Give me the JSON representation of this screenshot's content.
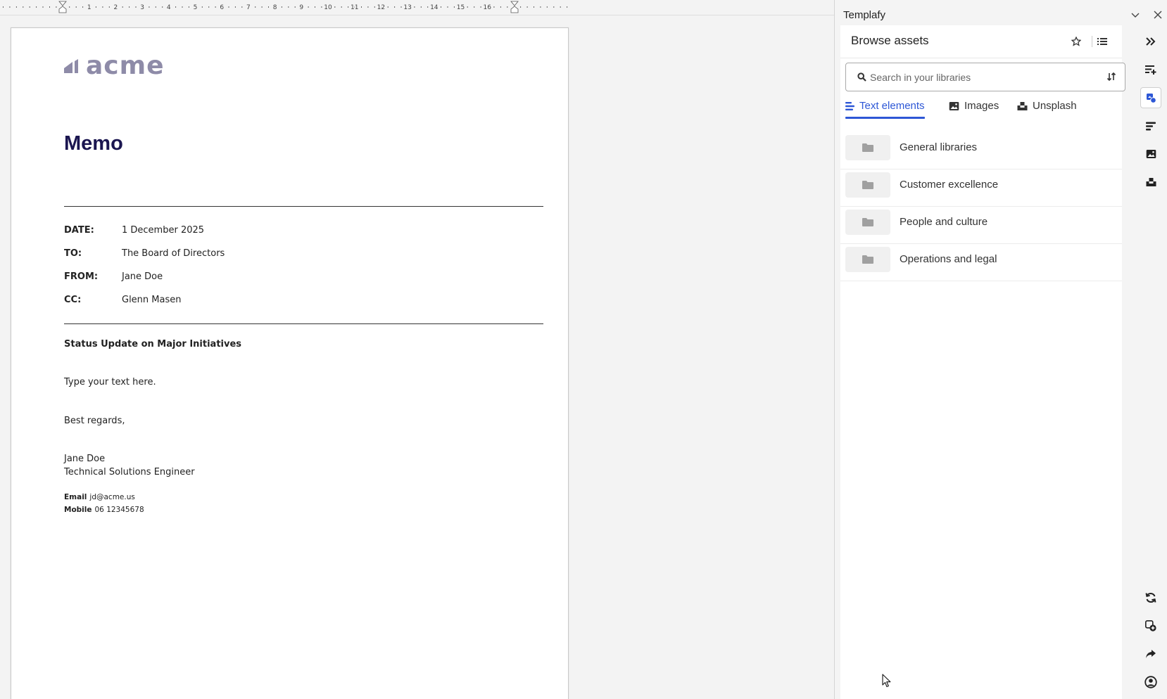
{
  "ruler": {
    "marks": [
      "1",
      "2",
      "3",
      "4",
      "5",
      "6",
      "7",
      "8",
      "9",
      "10",
      "11",
      "12",
      "13",
      "14",
      "15",
      "16"
    ]
  },
  "document": {
    "logo_text": "acme",
    "logo_color": "#8e8ba8",
    "title": "Memo",
    "title_color": "#1b1650",
    "fields": [
      {
        "label": "DATE:",
        "value": "1 December 2025"
      },
      {
        "label": "TO:",
        "value": "The Board of Directors"
      },
      {
        "label": "FROM:",
        "value": "Jane Doe"
      },
      {
        "label": "CC:",
        "value": "Glenn Masen"
      }
    ],
    "subject": "Status Update on Major Initiatives",
    "body": "Type your text here.",
    "closing": "Best regards,",
    "signature_name": "Jane Doe",
    "signature_title": "Technical Solutions Engineer",
    "email_label": "Email",
    "email_value": "jd@acme.us",
    "mobile_label": "Mobile",
    "mobile_value": "06 12345678"
  },
  "panel": {
    "title": "Templafy",
    "heading": "Browse assets",
    "search_placeholder": "Search in your libraries",
    "accent_color": "#2d57d6",
    "tabs": [
      {
        "label": "Text elements",
        "icon": "text-lines-icon",
        "active": true
      },
      {
        "label": "Images",
        "icon": "image-icon",
        "active": false
      },
      {
        "label": "Unsplash",
        "icon": "unsplash-icon",
        "active": false
      }
    ],
    "folders": [
      {
        "label": "General libraries",
        "icon": "folder-icon"
      },
      {
        "label": "Customer excellence",
        "icon": "folder-icon"
      },
      {
        "label": "People and culture",
        "icon": "folder-icon"
      },
      {
        "label": "Operations and legal",
        "icon": "folder-icon"
      }
    ],
    "rail_top": [
      "double-chevron-right-icon",
      "text-plus-icon",
      "assets-icon",
      "text-elements-icon",
      "image-icon",
      "unsplash-icon"
    ],
    "rail_bottom": [
      "refresh-icon",
      "add-copy-icon",
      "share-icon",
      "account-icon"
    ]
  }
}
